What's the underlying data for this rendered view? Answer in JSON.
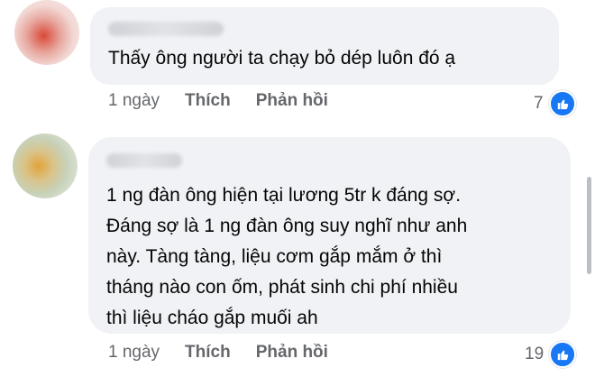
{
  "comments": [
    {
      "text": "Thấy ông người ta chạy bỏ dép luôn đó ạ",
      "time": "1 ngày",
      "like_label": "Thích",
      "reply_label": "Phản hồi",
      "reaction_count": "7",
      "reaction_icon": "like-thumb-icon"
    },
    {
      "text": "1 ng đàn ông hiện tại lương 5tr k đáng sợ.\nĐáng sợ là 1 ng đàn ông suy nghĩ như anh\nnày. Tàng tàng, liệu cơm gắp mắm ở thì\ntháng nào con ốm, phát sinh chi phí nhiều\nthì liệu cháo gắp muối ah",
      "time": "1 ngày",
      "like_label": "Thích",
      "reply_label": "Phản hồi",
      "reaction_count": "19",
      "reaction_icon": "like-thumb-icon"
    }
  ],
  "colors": {
    "bubble": "#f0f2f5",
    "text": "#050505",
    "meta": "#65676b",
    "like_blue": "#1877f2"
  }
}
